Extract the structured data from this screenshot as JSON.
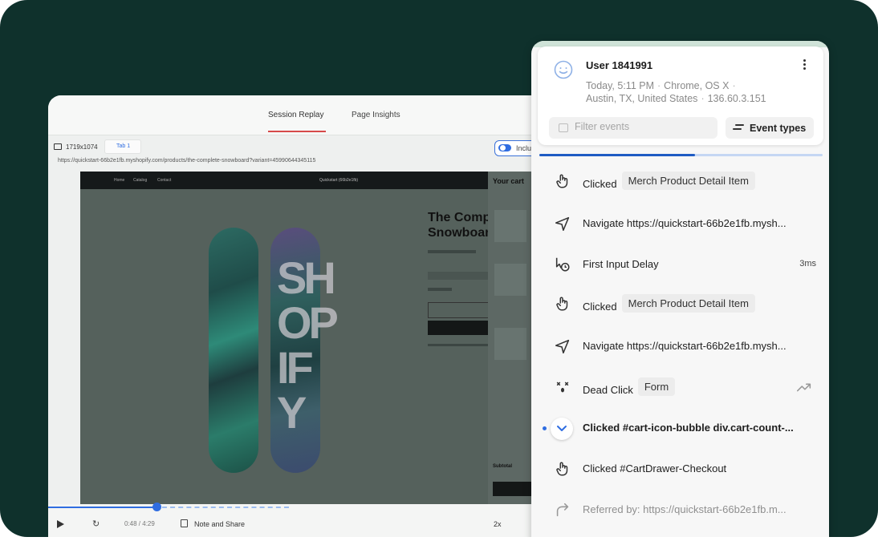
{
  "replay": {
    "tabs": [
      "Session Replay",
      "Page Insights"
    ],
    "resolution": "1719x1074",
    "tab_chip": "Tab 1",
    "toggle_label": "Inclu",
    "url": "https://quickstart-66b2e1fb.myshopify.com/products/the-complete-snowboard?variant=45990644345115",
    "site_nav": [
      "Home",
      "Catalog",
      "Contact"
    ],
    "site_brand": "Quickstart (66b2e1fb)",
    "product_title": "The Comp\nSnowboar",
    "board_text": "SH\nOP\nIF\nY",
    "cart_title": "Your cart",
    "cart_subtotal": "Subtotal",
    "time": "0:48 / 4:29",
    "note_label": "Note and Share",
    "speed": "2x",
    "played_fraction": 0.45
  },
  "panel": {
    "user": "User 1841991",
    "meta_line1": [
      "Today, 5:11 PM",
      "Chrome, OS X"
    ],
    "meta_line2": [
      "Austin, TX, United States",
      "136.60.3.151"
    ],
    "filter_placeholder": "Filter events",
    "event_types_label": "Event types",
    "progress_fraction": 0.55,
    "colors": {
      "accent": "#2f6de1",
      "progress": "#1f5cc4"
    }
  },
  "events": [
    {
      "icon": "pointer-hand-icon",
      "label": "Clicked",
      "tag": "Merch Product Detail Item"
    },
    {
      "icon": "navigate-arrow-icon",
      "label": "Navigate https://quickstart-66b2e1fb.mysh..."
    },
    {
      "icon": "cursor-clock-icon",
      "label": "First Input Delay",
      "meta": "3ms"
    },
    {
      "icon": "pointer-hand-icon",
      "label": "Clicked",
      "tag": "Merch Product Detail Item"
    },
    {
      "icon": "navigate-arrow-icon",
      "label": "Navigate https://quickstart-66b2e1fb.mysh..."
    },
    {
      "icon": "dead-face-icon",
      "label": "Dead Click",
      "tag": "Form"
    },
    {
      "icon": "chevron-down-icon",
      "label": "Clicked #cart-icon-bubble div.cart-count-..."
    },
    {
      "icon": "pointer-hand-icon",
      "label": "Clicked #CartDrawer-Checkout"
    },
    {
      "icon": "referral-arrow-icon",
      "label": "Referred by: https://quickstart-66b2e1fb.m..."
    }
  ]
}
